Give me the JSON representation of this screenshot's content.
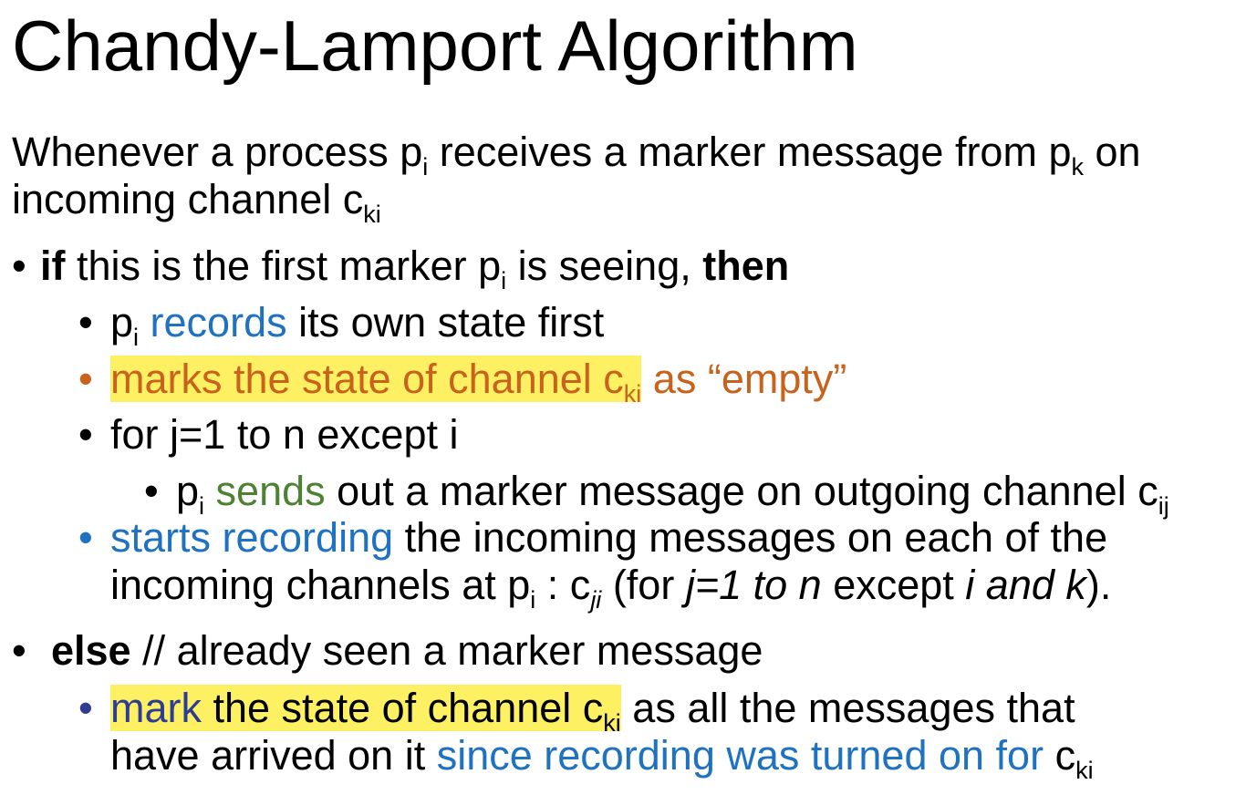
{
  "title": "Chandy-Lamport Algorithm",
  "bullet_glyph": "•",
  "intro": {
    "t1": "Whenever a process p",
    "t1_sub": "i",
    "t2": " receives a marker message from p",
    "t2_sub": "k",
    "t3": " on",
    "t4": "incoming channel c",
    "t4_sub": "ki"
  },
  "if_item": {
    "kw_if": "if",
    "t1": " this is the first marker p",
    "t1_sub": "i",
    "t2": " is seeing, ",
    "kw_then": "then"
  },
  "records_item": {
    "p": "p",
    "p_sub": "i",
    "records": "records",
    "rest": " its own state first"
  },
  "marks_item": {
    "highlighted": "marks the state of channel c",
    "highlighted_sub": "ki",
    "rest": " as “empty”"
  },
  "for_item": {
    "text": "for j=1 to n except i"
  },
  "sends_item": {
    "p": "p",
    "p_sub": "i",
    "sends": "sends",
    "rest": " out a marker message on outgoing channel c",
    "rest_sub": "ij"
  },
  "starts_item": {
    "starts": "starts recording",
    "t1": " the incoming messages on each of the",
    "t2": "incoming channels at p",
    "t2_sub": "i",
    "t3": " : c",
    "t3_sub": "ji",
    "t4": " (for ",
    "t5": "j=1 to n",
    "t6": " except ",
    "t7": "i and k",
    "t8": ")."
  },
  "else_item": {
    "kw_else": "else",
    "rest": " // already seen a marker message"
  },
  "mark_item": {
    "mark": "mark",
    "t1": " the state of channel c",
    "t1_sub": "ki",
    "t2": " as all the messages that",
    "t3": "have arrived on it ",
    "t4": "since recording was turned on for",
    "t5": " c",
    "t5_sub": "ki"
  }
}
